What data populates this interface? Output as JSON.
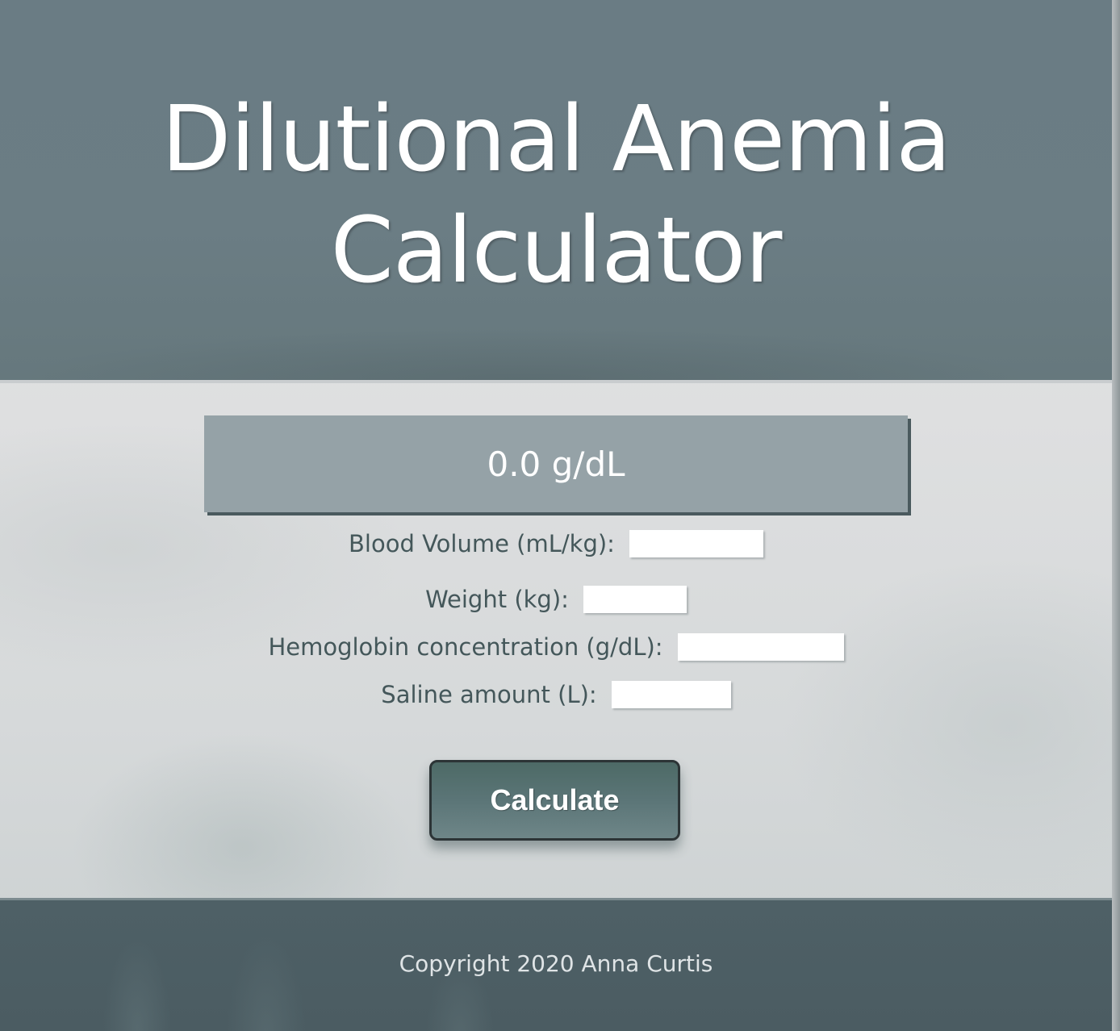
{
  "header": {
    "title_line1": "Dilutional Anemia",
    "title_line2": "Calculator"
  },
  "result": {
    "value_text": "0.0 g/dL"
  },
  "form": {
    "fields": [
      {
        "label": "Blood Volume (mL/kg):",
        "value": ""
      },
      {
        "label": "Weight (kg):",
        "value": ""
      },
      {
        "label": "Hemoglobin concentration (g/dL):",
        "value": ""
      },
      {
        "label": "Saline amount (L):",
        "value": ""
      }
    ],
    "calculate_label": "Calculate"
  },
  "footer": {
    "copyright": "Copyright 2020 Anna Curtis"
  },
  "colors": {
    "header_bg": "#6a7c84",
    "result_bg": "#95a2a7",
    "label_text": "#44575a",
    "button_bg": "#5b7577",
    "footer_bg": "#4e6066"
  }
}
